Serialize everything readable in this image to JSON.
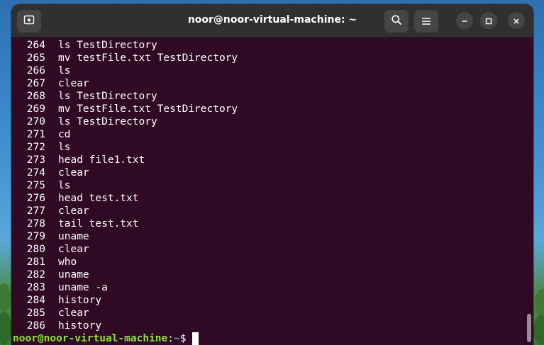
{
  "window": {
    "title": "noor@noor-virtual-machine: ~",
    "background_color": "#300a24",
    "titlebar_color": "#303030"
  },
  "titlebar": {
    "new_tab_icon": "new-tab-icon",
    "search_icon": "search-icon",
    "menu_icon": "hamburger-menu-icon",
    "minimize_icon": "minimize-icon",
    "maximize_icon": "maximize-icon",
    "close_icon": "close-icon"
  },
  "history": [
    {
      "num": "264",
      "cmd": "ls TestDirectory"
    },
    {
      "num": "265",
      "cmd": "mv testFile.txt TestDirectory"
    },
    {
      "num": "266",
      "cmd": "ls"
    },
    {
      "num": "267",
      "cmd": "clear"
    },
    {
      "num": "268",
      "cmd": "ls TestDirectory"
    },
    {
      "num": "269",
      "cmd": "mv TestFile.txt TestDirectory"
    },
    {
      "num": "270",
      "cmd": "ls TestDirectory"
    },
    {
      "num": "271",
      "cmd": "cd"
    },
    {
      "num": "272",
      "cmd": "ls"
    },
    {
      "num": "273",
      "cmd": "head file1.txt"
    },
    {
      "num": "274",
      "cmd": "clear"
    },
    {
      "num": "275",
      "cmd": "ls"
    },
    {
      "num": "276",
      "cmd": "head test.txt"
    },
    {
      "num": "277",
      "cmd": "clear"
    },
    {
      "num": "278",
      "cmd": "tail test.txt"
    },
    {
      "num": "279",
      "cmd": "uname"
    },
    {
      "num": "280",
      "cmd": "clear"
    },
    {
      "num": "281",
      "cmd": "who"
    },
    {
      "num": "282",
      "cmd": "uname"
    },
    {
      "num": "283",
      "cmd": "uname -a"
    },
    {
      "num": "284",
      "cmd": "history"
    },
    {
      "num": "285",
      "cmd": "clear"
    },
    {
      "num": "286",
      "cmd": "history"
    }
  ],
  "prompt": {
    "user_host": "noor@noor-virtual-machine",
    "colon": ":",
    "path": "~",
    "symbol": "$",
    "user_color": "#8ae234",
    "path_color": "#729fcf"
  }
}
